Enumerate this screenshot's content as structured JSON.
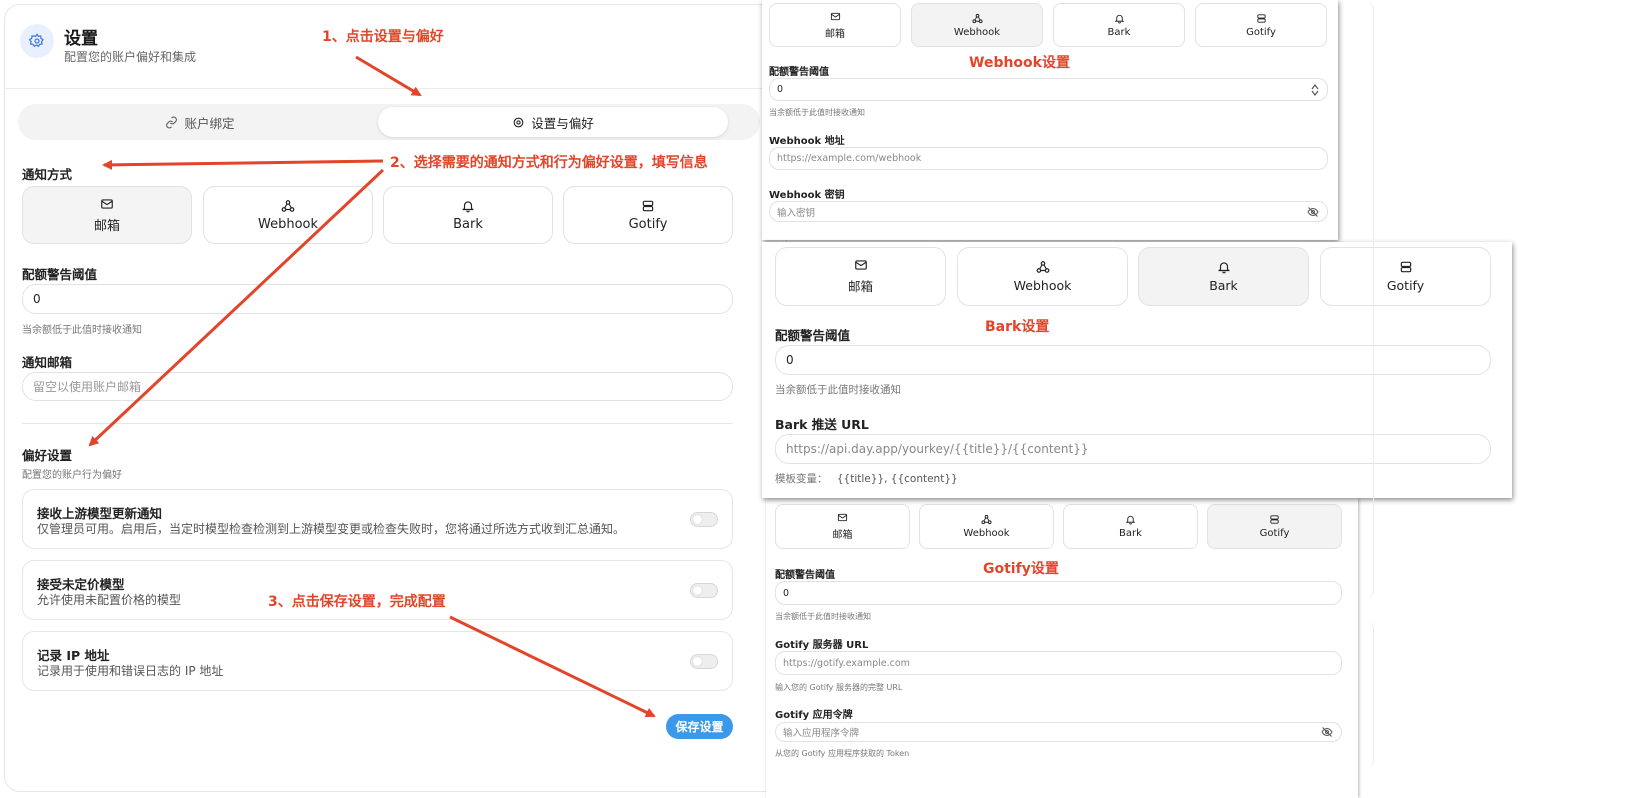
{
  "header": {
    "title": "设置",
    "subtitle": "配置您的账户偏好和集成"
  },
  "tabs": [
    {
      "label": "账户绑定"
    },
    {
      "label": "设置与偏好"
    }
  ],
  "notify": {
    "section_label": "通知方式",
    "channels": [
      {
        "label": "邮箱",
        "icon": "mail-icon"
      },
      {
        "label": "Webhook",
        "icon": "webhook-icon"
      },
      {
        "label": "Bark",
        "icon": "bell-icon"
      },
      {
        "label": "Gotify",
        "icon": "server-icon"
      }
    ],
    "threshold_label": "配额警告阈值",
    "threshold_value": "0",
    "threshold_hint": "当余额低于此值时接收通知",
    "email_label": "通知邮箱",
    "email_placeholder": "留空以使用账户邮箱"
  },
  "prefs": {
    "section_label": "偏好设置",
    "section_hint": "配置您的账户行为偏好",
    "items": [
      {
        "title": "接收上游模型更新通知",
        "desc": "仅管理员可用。启用后，当定时模型检查检测到上游模型变更或检查失败时，您将通过所选方式收到汇总通知。"
      },
      {
        "title": "接受未定价模型",
        "desc": "允许使用未配置价格的模型"
      },
      {
        "title": "记录 IP 地址",
        "desc": "记录用于使用和错误日志的 IP 地址"
      }
    ],
    "save_label": "保存设置"
  },
  "annotations": {
    "step1": "1、点击设置与偏好",
    "step2": "2、选择需要的通知方式和行为偏好设置，填写信息",
    "step3": "3、点击保存设置，完成配置",
    "webhook_title": "Webhook设置",
    "bark_title": "Bark设置",
    "gotify_title": "Gotify设置",
    "color": "#e2452a"
  },
  "webhook_panel": {
    "threshold_label": "配额警告阈值",
    "threshold_value": "0",
    "threshold_hint": "当余额低于此值时接收通知",
    "url_label": "Webhook 地址",
    "url_placeholder": "https://example.com/webhook",
    "secret_label": "Webhook 密钥",
    "secret_placeholder": "输入密钥"
  },
  "bark_panel": {
    "threshold_label": "配额警告阈值",
    "threshold_value": "0",
    "threshold_hint": "当余额低于此值时接收通知",
    "url_label": "Bark 推送 URL",
    "url_placeholder": "https://api.day.app/yourkey/{{title}}/{{content}}",
    "template_label": "模板变量：",
    "template_vars": "{{title}}, {{content}}"
  },
  "gotify_panel": {
    "threshold_label": "配额警告阈值",
    "threshold_value": "0",
    "threshold_hint": "当余额低于此值时接收通知",
    "url_label": "Gotify 服务器 URL",
    "url_placeholder": "https://gotify.example.com",
    "url_hint": "输入您的 Gotify 服务器的完整 URL",
    "token_label": "Gotify 应用令牌",
    "token_placeholder": "输入应用程序令牌",
    "token_hint": "从您的 Gotify 应用程序获取的 Token"
  },
  "colors": {
    "accent": "#3a9ae9",
    "annotation": "#e2452a"
  }
}
